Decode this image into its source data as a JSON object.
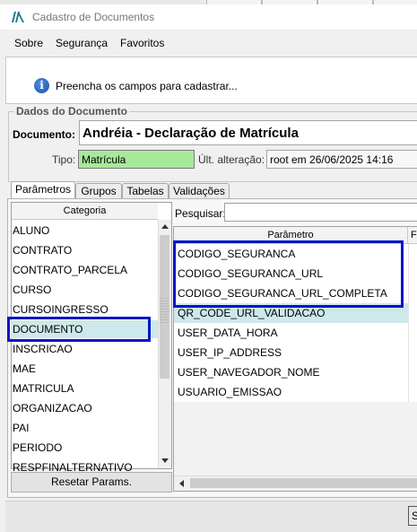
{
  "window": {
    "title": "Cadastro de Documentos"
  },
  "menu": {
    "items": [
      {
        "label": "Sobre"
      },
      {
        "label": "Segurança"
      },
      {
        "label": "Favoritos"
      }
    ]
  },
  "info": {
    "icon": "info-icon",
    "icon_glyph": "i",
    "message": "Preencha os campos para cadastrar..."
  },
  "document": {
    "group_title": "Dados do Documento",
    "documento_label": "Documento:",
    "documento_value": "Andréia - Declaração de Matrícula",
    "tipo_label": "Tipo:",
    "tipo_value": "Matrícula",
    "ult_label": "Últ. alteração:",
    "ult_value": "root em 26/06/2025 14:16"
  },
  "tabs": [
    {
      "label": "Parâmetros"
    },
    {
      "label": "Grupos"
    },
    {
      "label": "Tabelas"
    },
    {
      "label": "Validações"
    }
  ],
  "categories": {
    "header": "Categoria",
    "items": [
      "ALUNO",
      "CONTRATO",
      "CONTRATO_PARCELA",
      "CURSO",
      "CURSOINGRESSO",
      "DOCUMENTO",
      "INSCRICAO",
      "MAE",
      "MATRICULA",
      "ORGANIZACAO",
      "PAI",
      "PERIODO",
      "RESPFINALTERNATIVO"
    ],
    "selected": "DOCUMENTO",
    "reset_label": "Resetar Params."
  },
  "search": {
    "label": "Pesquisar:",
    "value": ""
  },
  "parameters": {
    "header": "Parâmetro",
    "header2": "F",
    "items": [
      "CODIGO_SEGURANCA",
      "CODIGO_SEGURANCA_URL",
      "CODIGO_SEGURANCA_URL_COMPLETA",
      "QR_CODE_URL_VALIDACAO",
      "USER_DATA_HORA",
      "USER_IP_ADDRESS",
      "USER_NAVEGADOR_NOME",
      "USUARIO_EMISSAO"
    ],
    "selected": "QR_CODE_URL_VALIDACAO"
  },
  "bottom": {
    "button_label": "S"
  },
  "colors": {
    "highlight_box": "#0015c8",
    "selection": "#cde9eb",
    "tipo_field": "#a7e99a"
  }
}
